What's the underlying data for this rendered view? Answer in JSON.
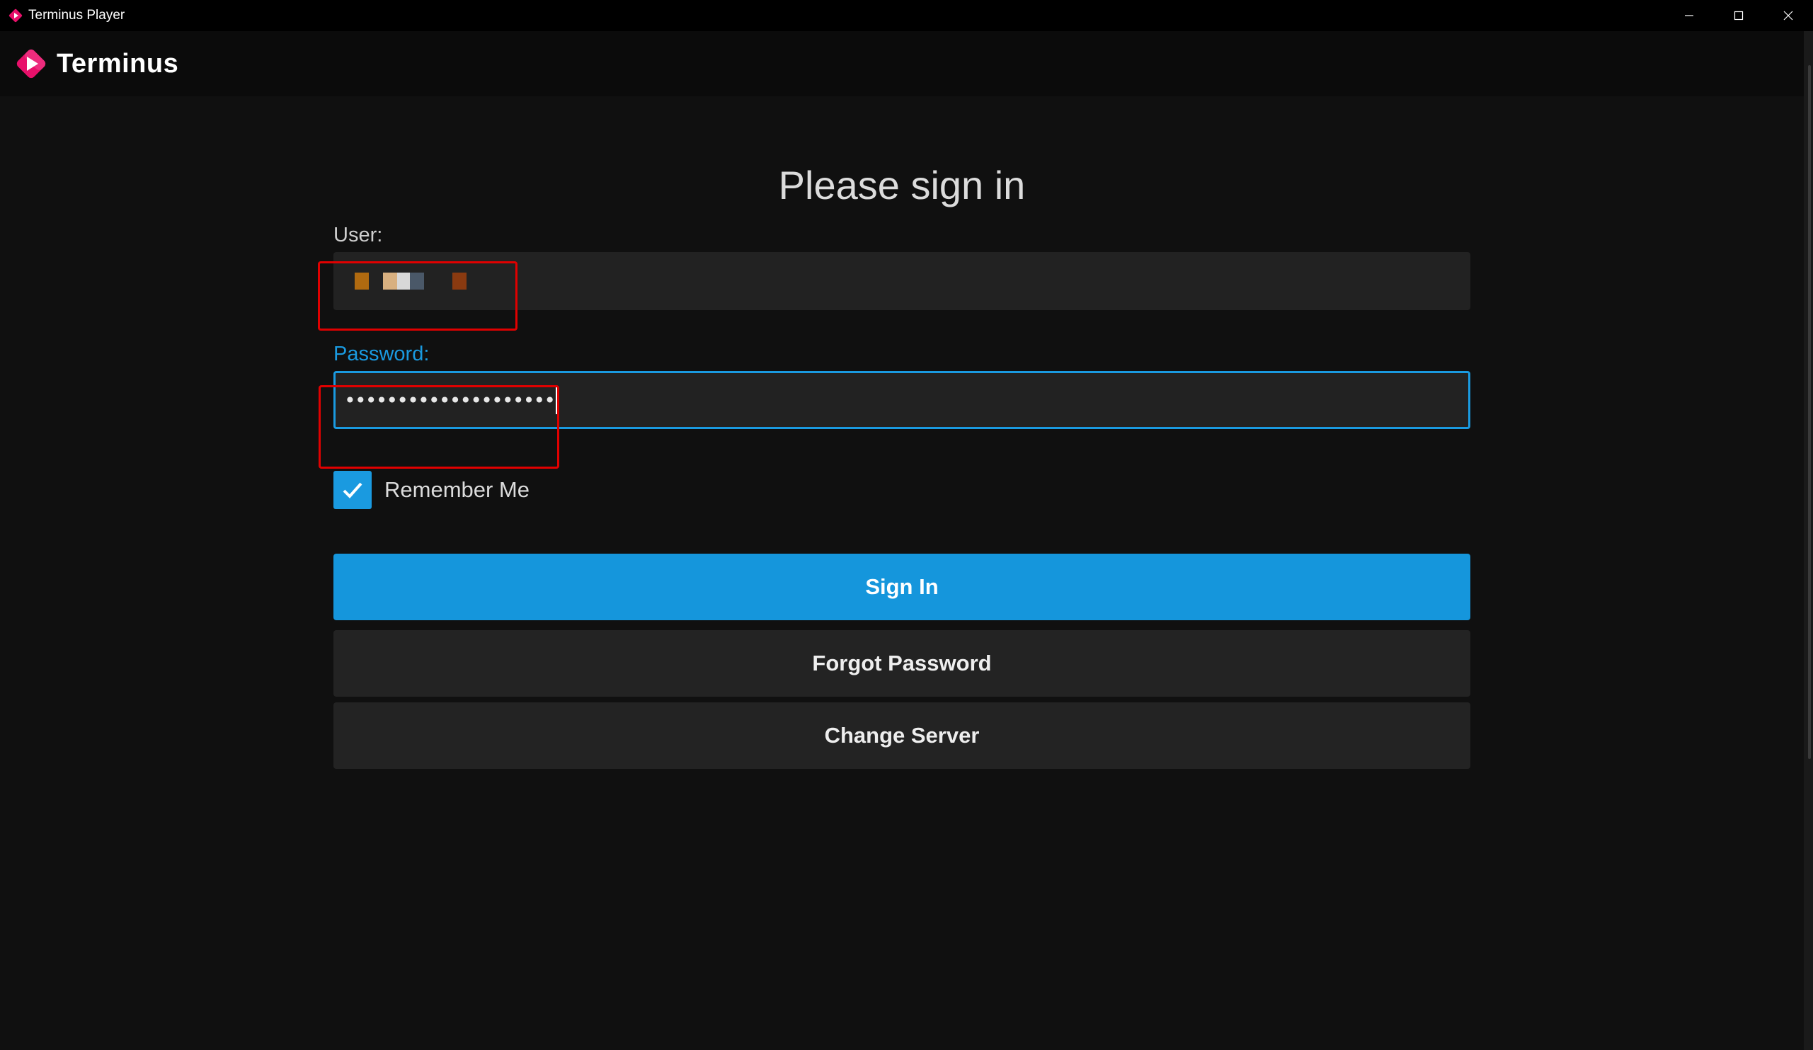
{
  "window": {
    "title": "Terminus Player",
    "controls": [
      "minimize-icon",
      "maximize-icon",
      "close-icon"
    ]
  },
  "header": {
    "app_name": "Terminus",
    "logo_colors": [
      "#e8106a",
      "#f0408a"
    ]
  },
  "form": {
    "heading": "Please sign in",
    "user_label": "User:",
    "user_value_redacted": true,
    "password_label": "Password:",
    "password_value": "••••••••••••••••••••",
    "remember_label": "Remember Me",
    "remember_checked": true,
    "sign_in_label": "Sign In",
    "forgot_label": "Forgot Password",
    "change_server_label": "Change Server"
  },
  "colors": {
    "accent": "#1596dc",
    "background": "#101010",
    "input_bg": "#222222",
    "annotation": "#e00000"
  }
}
